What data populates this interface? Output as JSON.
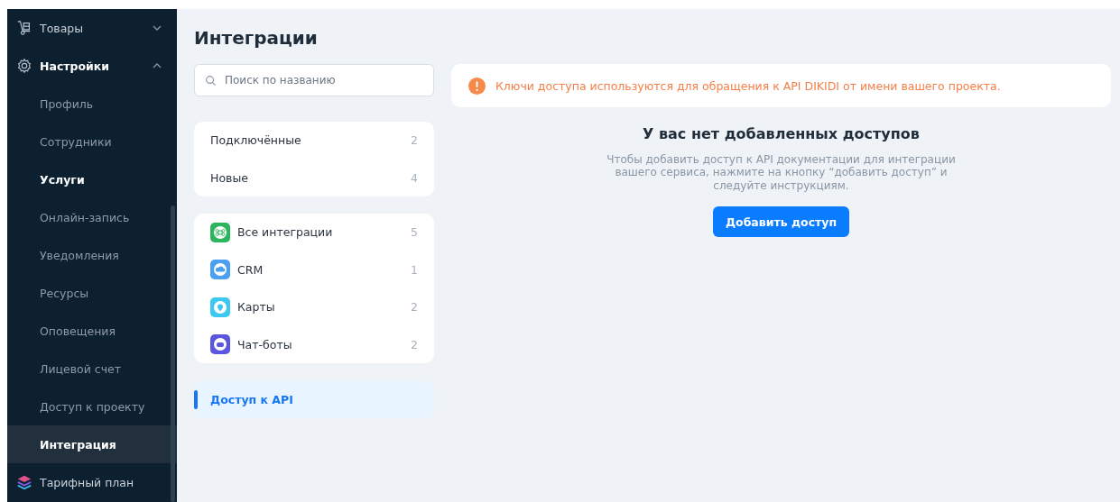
{
  "sidebar": {
    "items": [
      {
        "label": "Товары",
        "kind": "cart",
        "expanded": false
      },
      {
        "label": "Настройки",
        "kind": "gear",
        "expanded": true,
        "children": [
          {
            "label": "Профиль",
            "selected": false,
            "bold": false
          },
          {
            "label": "Сотрудники",
            "selected": false,
            "bold": false
          },
          {
            "label": "Услуги",
            "selected": false,
            "bold": true
          },
          {
            "label": "Онлайн-запись",
            "selected": false,
            "bold": false
          },
          {
            "label": "Уведомления",
            "selected": false,
            "bold": false
          },
          {
            "label": "Ресурсы",
            "selected": false,
            "bold": false
          },
          {
            "label": "Оповещения",
            "selected": false,
            "bold": false
          },
          {
            "label": "Лицевой счет",
            "selected": false,
            "bold": false
          },
          {
            "label": "Доступ к проекту",
            "selected": false,
            "bold": false
          },
          {
            "label": "Интеграция",
            "selected": true,
            "bold": true
          }
        ]
      },
      {
        "label": "Тарифный план",
        "kind": "layers"
      }
    ]
  },
  "page": {
    "title": "Интеграции"
  },
  "search": {
    "placeholder": "Поиск по названию"
  },
  "filters": [
    {
      "label": "Подключённые",
      "count": "2",
      "selected": false
    },
    {
      "label": "Новые",
      "count": "4",
      "selected": false
    }
  ],
  "categories": [
    {
      "label": "Все интеграции",
      "count": "5",
      "kind": "command",
      "color": "#2db55d",
      "selected": false
    },
    {
      "label": "CRM",
      "count": "1",
      "kind": "cloud",
      "color": "#4a9ff0",
      "selected": false
    },
    {
      "label": "Карты",
      "count": "2",
      "kind": "pin",
      "color": "#3cc8f0",
      "selected": false
    },
    {
      "label": "Чат-боты",
      "count": "2",
      "kind": "bot",
      "color": "#5a56e0",
      "selected": false
    }
  ],
  "api_item": {
    "label": "Доступ к API",
    "selected": true
  },
  "notice": {
    "text": "Ключи доступа используются для обращения к API DIKIDI от имени вашего проекта."
  },
  "empty": {
    "title": "У вас нет добавленных доступов",
    "text": "Чтобы добавить доступ к API документации для интеграции вашего сервиса, нажмите на кнопку “добавить доступ” и следуйте инструкциям.",
    "button": "Добавить доступ"
  }
}
